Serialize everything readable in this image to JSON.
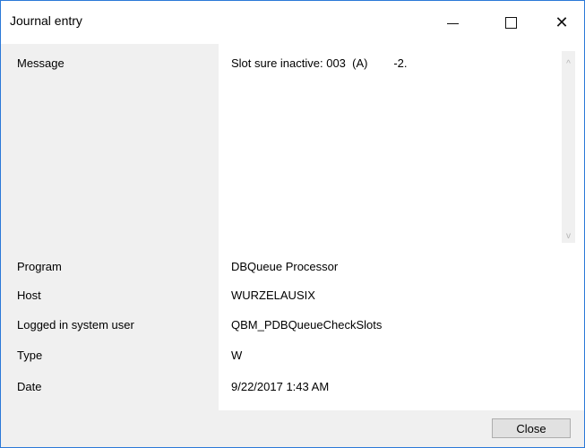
{
  "window": {
    "title": "Journal entry"
  },
  "message": {
    "label": "Message",
    "value": "Slot sure inactive: 003  (A)        -2."
  },
  "fields": [
    {
      "label": "Program",
      "value": "DBQueue Processor"
    },
    {
      "label": "Host",
      "value": "WURZELAUSIX"
    },
    {
      "label": "Logged in system user",
      "value": "QBM_PDBQueueCheckSlots"
    },
    {
      "label": "Type",
      "value": "W"
    },
    {
      "label": "Date",
      "value": "9/22/2017 1:43 AM"
    }
  ],
  "footer": {
    "close_label": "Close"
  },
  "icons": {
    "minimize": "minimize-icon",
    "maximize": "maximize-icon",
    "close": "close-icon",
    "scroll_up": "chevron-up-icon",
    "scroll_down": "chevron-down-icon"
  }
}
